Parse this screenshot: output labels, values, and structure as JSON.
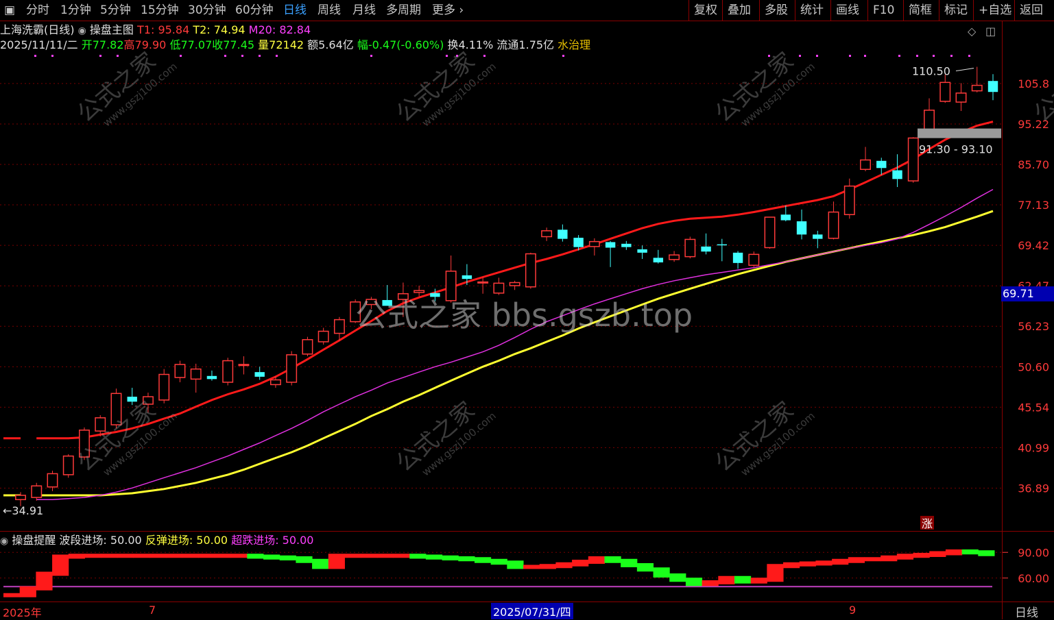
{
  "toolbar": {
    "left_items": [
      "分时",
      "1分钟",
      "5分钟",
      "15分钟",
      "30分钟",
      "60分钟",
      "日线",
      "周线",
      "月线",
      "多周期",
      "更多"
    ],
    "active": "日线",
    "right_items": [
      "复权",
      "叠加",
      "多股",
      "统计",
      "画线",
      "F10",
      "简框",
      "标记",
      "+自选",
      "返回"
    ]
  },
  "stock": {
    "name": "上海洗霸(日线)",
    "indicator": "操盘主图",
    "t1_label": "T1: 95.84",
    "t2_label": "T2: 74.94",
    "m20_label": "M20: 82.84",
    "date": "2025/11/11/二",
    "open": "开77.82",
    "high": "高79.90",
    "low": "低77.07",
    "close": "收77.45",
    "volume": "量72142",
    "amount": "额5.64亿",
    "change": "幅-0.47(-0.60%)",
    "turnover": "换4.11%",
    "float": "流通1.75亿",
    "concept": "水治理"
  },
  "price_axis": [
    "105.8",
    "95.22",
    "85.70",
    "77.13",
    "69.42",
    "62.47",
    "56.23",
    "50.60",
    "45.54",
    "40.99",
    "36.89"
  ],
  "cursor_price": "69.71",
  "annotations": {
    "high_label": "110.50",
    "low_label": "34.91",
    "zone_label": "91.30 - 93.10",
    "zhang_badge": "涨"
  },
  "watermark_center": "公式之家 bbs.gszb.top",
  "watermark_small": "公式之家",
  "watermark_url": "www.gszj100.com",
  "sub_indicator": {
    "name": "操盘提醒",
    "wave": "波段进场: 50.00",
    "rebound": "反弹进场: 50.00",
    "oversold": "超跌进场: 50.00",
    "axis": [
      "90.00",
      "60.00"
    ]
  },
  "dates": {
    "start": "2025年",
    "m7": "7",
    "cursor_date": "2025/07/31/四",
    "m9": "9",
    "period": "日线"
  },
  "colors": {
    "up": "#ff3a3a",
    "down": "#40ffff",
    "ma_red": "#ff1a1a",
    "ma_mag": "#e030e0",
    "ma_yellow": "#ffff30",
    "frame": "#8b0000"
  },
  "chart_data": {
    "type": "candlestick",
    "candles": [
      {
        "o": 35.8,
        "h": 36.5,
        "l": 35.2,
        "c": 36.2
      },
      {
        "o": 36.0,
        "h": 37.4,
        "l": 35.7,
        "c": 37.1
      },
      {
        "o": 37.0,
        "h": 38.6,
        "l": 36.6,
        "c": 38.3
      },
      {
        "o": 38.2,
        "h": 40.3,
        "l": 37.9,
        "c": 40.1
      },
      {
        "o": 40.0,
        "h": 43.2,
        "l": 39.7,
        "c": 42.9
      },
      {
        "o": 42.8,
        "h": 44.6,
        "l": 42.2,
        "c": 44.3
      },
      {
        "o": 43.5,
        "h": 47.8,
        "l": 43.1,
        "c": 47.2
      },
      {
        "o": 46.8,
        "h": 47.9,
        "l": 45.8,
        "c": 46.2
      },
      {
        "o": 45.9,
        "h": 47.3,
        "l": 44.9,
        "c": 46.8
      },
      {
        "o": 46.4,
        "h": 50.3,
        "l": 46.0,
        "c": 49.6
      },
      {
        "o": 49.2,
        "h": 51.4,
        "l": 48.6,
        "c": 50.9
      },
      {
        "o": 49.0,
        "h": 51.0,
        "l": 47.3,
        "c": 50.3
      },
      {
        "o": 49.4,
        "h": 50.1,
        "l": 48.8,
        "c": 49.0
      },
      {
        "o": 48.6,
        "h": 51.8,
        "l": 48.2,
        "c": 51.4
      },
      {
        "o": 50.9,
        "h": 52.0,
        "l": 49.6,
        "c": 50.9
      },
      {
        "o": 49.9,
        "h": 50.6,
        "l": 48.9,
        "c": 49.3
      },
      {
        "o": 48.3,
        "h": 49.4,
        "l": 47.9,
        "c": 48.9
      },
      {
        "o": 48.6,
        "h": 52.7,
        "l": 48.2,
        "c": 52.2
      },
      {
        "o": 52.3,
        "h": 54.7,
        "l": 52.0,
        "c": 54.3
      },
      {
        "o": 54.0,
        "h": 56.0,
        "l": 53.6,
        "c": 55.5
      },
      {
        "o": 55.2,
        "h": 57.6,
        "l": 54.1,
        "c": 57.2
      },
      {
        "o": 56.9,
        "h": 60.3,
        "l": 56.7,
        "c": 59.9
      },
      {
        "o": 59.5,
        "h": 60.7,
        "l": 58.8,
        "c": 60.3
      },
      {
        "o": 60.2,
        "h": 62.6,
        "l": 59.8,
        "c": 59.3
      },
      {
        "o": 60.3,
        "h": 63.0,
        "l": 57.6,
        "c": 61.2
      },
      {
        "o": 61.4,
        "h": 62.5,
        "l": 60.8,
        "c": 61.7
      },
      {
        "o": 61.3,
        "h": 62.0,
        "l": 60.0,
        "c": 60.7
      },
      {
        "o": 60.1,
        "h": 67.6,
        "l": 59.8,
        "c": 64.9
      },
      {
        "o": 64.2,
        "h": 66.1,
        "l": 62.6,
        "c": 63.6
      },
      {
        "o": 63.1,
        "h": 63.8,
        "l": 61.2,
        "c": 63.1
      },
      {
        "o": 61.3,
        "h": 63.8,
        "l": 61.0,
        "c": 62.9
      },
      {
        "o": 62.5,
        "h": 63.3,
        "l": 61.8,
        "c": 63.0
      },
      {
        "o": 62.3,
        "h": 68.1,
        "l": 62.0,
        "c": 67.9
      },
      {
        "o": 71.0,
        "h": 72.7,
        "l": 70.2,
        "c": 72.1
      },
      {
        "o": 72.3,
        "h": 73.3,
        "l": 70.1,
        "c": 70.6
      },
      {
        "o": 70.8,
        "h": 71.3,
        "l": 68.5,
        "c": 69.1
      },
      {
        "o": 69.2,
        "h": 70.7,
        "l": 67.6,
        "c": 70.1
      },
      {
        "o": 70.0,
        "h": 70.2,
        "l": 65.6,
        "c": 69.0
      },
      {
        "o": 69.7,
        "h": 70.2,
        "l": 68.6,
        "c": 69.1
      },
      {
        "o": 68.7,
        "h": 69.4,
        "l": 67.0,
        "c": 68.1
      },
      {
        "o": 67.2,
        "h": 68.6,
        "l": 66.2,
        "c": 66.4
      },
      {
        "o": 66.9,
        "h": 68.4,
        "l": 66.5,
        "c": 67.7
      },
      {
        "o": 67.4,
        "h": 71.0,
        "l": 67.1,
        "c": 70.5
      },
      {
        "o": 69.2,
        "h": 71.6,
        "l": 67.8,
        "c": 68.3
      },
      {
        "o": 69.6,
        "h": 70.6,
        "l": 66.6,
        "c": 69.5
      },
      {
        "o": 68.1,
        "h": 68.4,
        "l": 65.3,
        "c": 66.3
      },
      {
        "o": 65.9,
        "h": 68.3,
        "l": 65.6,
        "c": 67.8
      },
      {
        "o": 69.0,
        "h": 74.7,
        "l": 68.8,
        "c": 74.7
      },
      {
        "o": 75.2,
        "h": 77.0,
        "l": 73.9,
        "c": 74.1
      },
      {
        "o": 73.9,
        "h": 76.2,
        "l": 70.5,
        "c": 71.4
      },
      {
        "o": 71.4,
        "h": 72.1,
        "l": 68.9,
        "c": 70.6
      },
      {
        "o": 70.7,
        "h": 77.8,
        "l": 70.5,
        "c": 75.7
      },
      {
        "o": 75.2,
        "h": 82.6,
        "l": 74.4,
        "c": 81.0
      },
      {
        "o": 84.6,
        "h": 89.7,
        "l": 84.2,
        "c": 86.7
      },
      {
        "o": 86.5,
        "h": 87.2,
        "l": 83.4,
        "c": 84.9
      },
      {
        "o": 84.4,
        "h": 88.0,
        "l": 80.8,
        "c": 82.5
      },
      {
        "o": 82.1,
        "h": 92.0,
        "l": 81.7,
        "c": 91.8
      },
      {
        "o": 92.6,
        "h": 101.8,
        "l": 92.3,
        "c": 98.7
      },
      {
        "o": 101.0,
        "h": 108.3,
        "l": 100.6,
        "c": 106.1
      },
      {
        "o": 100.8,
        "h": 105.9,
        "l": 98.5,
        "c": 103.2
      },
      {
        "o": 103.8,
        "h": 110.5,
        "l": 103.4,
        "c": 105.3
      },
      {
        "o": 106.5,
        "h": 108.4,
        "l": 101.3,
        "c": 103.5
      }
    ],
    "ma_red": [
      42.0,
      42.0,
      42.0,
      42.1,
      42.4,
      42.7,
      43.1,
      43.6,
      44.2,
      44.8,
      45.6,
      46.4,
      47.1,
      47.7,
      48.4,
      49.3,
      50.4,
      51.6,
      52.9,
      54.2,
      55.6,
      57.0,
      58.5,
      59.7,
      60.6,
      61.4,
      62.2,
      63.1,
      63.9,
      64.7,
      65.5,
      66.3,
      67.0,
      67.8,
      68.7,
      69.6,
      70.6,
      71.6,
      72.6,
      73.4,
      74.0,
      74.4,
      74.6,
      74.8,
      75.2,
      75.7,
      76.3,
      76.9,
      77.5,
      78.1,
      78.9,
      80.3,
      81.8,
      83.4,
      85.0,
      86.9,
      89.2,
      91.4,
      93.2,
      94.8,
      95.8
    ],
    "ma_mag": [
      35.8,
      35.8,
      35.9,
      36.0,
      36.2,
      36.5,
      36.9,
      37.4,
      37.9,
      38.4,
      38.9,
      39.5,
      40.1,
      40.8,
      41.5,
      42.3,
      43.1,
      44.0,
      45.0,
      45.9,
      46.8,
      47.6,
      48.5,
      49.2,
      49.9,
      50.6,
      51.2,
      51.9,
      52.6,
      53.5,
      54.6,
      55.8,
      56.9,
      57.8,
      58.7,
      59.6,
      60.4,
      61.2,
      62.0,
      62.7,
      63.3,
      63.8,
      64.3,
      64.7,
      65.1,
      65.5,
      66.0,
      66.5,
      67.1,
      67.7,
      68.3,
      68.9,
      69.4,
      69.9,
      70.6,
      71.8,
      73.3,
      74.9,
      76.6,
      78.5,
      80.3
    ],
    "ma_yellow": [
      36.2,
      36.2,
      36.2,
      36.2,
      36.2,
      36.3,
      36.4,
      36.6,
      36.8,
      37.1,
      37.4,
      37.8,
      38.2,
      38.7,
      39.3,
      39.9,
      40.5,
      41.2,
      42.0,
      42.8,
      43.6,
      44.5,
      45.3,
      46.2,
      47.0,
      47.9,
      48.8,
      49.7,
      50.6,
      51.4,
      52.3,
      53.1,
      54.0,
      54.9,
      55.9,
      56.8,
      57.7,
      58.6,
      59.5,
      60.4,
      61.2,
      62.0,
      62.8,
      63.6,
      64.4,
      65.1,
      65.8,
      66.5,
      67.1,
      67.7,
      68.3,
      68.9,
      69.5,
      70.1,
      70.7,
      71.3,
      72.0,
      72.8,
      73.8,
      74.8,
      75.9
    ],
    "y_scale": "log",
    "ylim": [
      34.5,
      113
    ],
    "sub_values": [
      40,
      48,
      65,
      85,
      86,
      86,
      86,
      86,
      86,
      86,
      86,
      86,
      86,
      86,
      86,
      85,
      84,
      83,
      80,
      73,
      86,
      86,
      86,
      86,
      86,
      85,
      84,
      83,
      82,
      80,
      78,
      73,
      73,
      74,
      76,
      79,
      83,
      80,
      75,
      70,
      63,
      58,
      53,
      55,
      60,
      56,
      58,
      74,
      76,
      77,
      78,
      80,
      82,
      82,
      84,
      86,
      87,
      89,
      91,
      90,
      88
    ]
  }
}
